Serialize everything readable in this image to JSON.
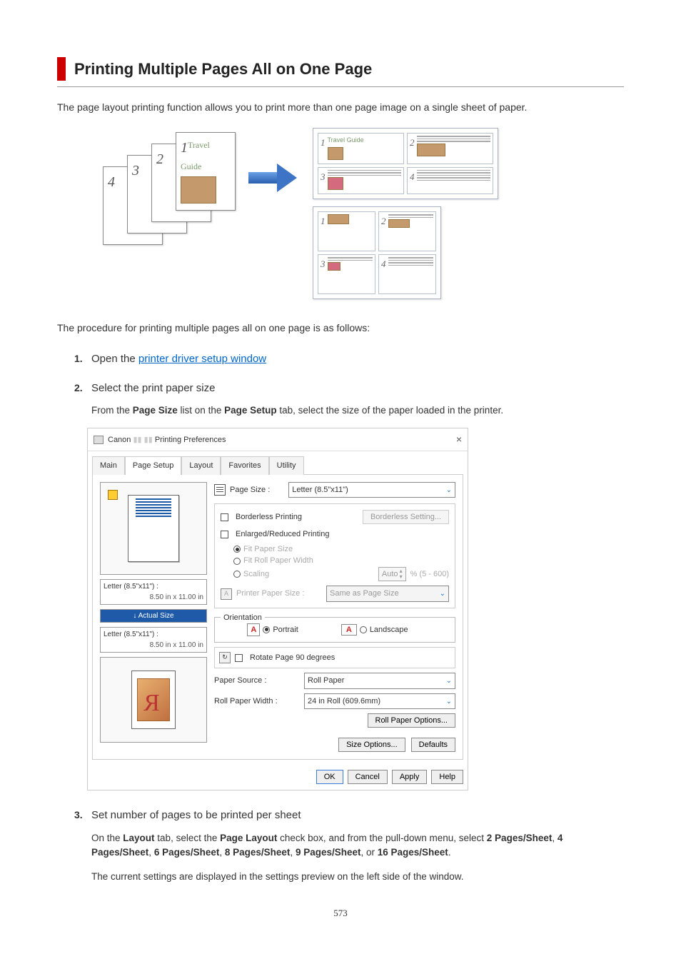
{
  "title": "Printing Multiple Pages All on One Page",
  "intro": "The page layout printing function allows you to print more than one page image on a single sheet of paper.",
  "procedure": "The procedure for printing multiple pages all on one page is as follows:",
  "steps": {
    "s1": {
      "num": "1.",
      "title_pre": "Open the ",
      "link": "printer driver setup window"
    },
    "s2": {
      "num": "2.",
      "title": "Select the print paper size",
      "detail_pre": "From the ",
      "b1": "Page Size",
      "mid1": " list on the ",
      "b2": "Page Setup",
      "post": " tab, select the size of the paper loaded in the printer."
    },
    "s3": {
      "num": "3.",
      "title": "Set number of pages to be printed per sheet",
      "l1_pre": "On the ",
      "l1_b1": "Layout",
      "l1_mid": " tab, select the ",
      "l1_b2": "Page Layout",
      "l1_mid2": " check box, and from the pull-down menu, select ",
      "l1_b3": "2 Pages/Sheet",
      "l1_c1": ", ",
      "l1_b4": "4 Pages/Sheet",
      "l1_c2": ", ",
      "l1_b5": "6 Pages/Sheet",
      "l1_c3": ", ",
      "l1_b6": "8 Pages/Sheet",
      "l1_c4": ", ",
      "l1_b7": "9 Pages/Sheet",
      "l1_c5": ", or ",
      "l1_b8": "16 Pages/Sheet",
      "l1_end": ".",
      "l2": "The current settings are displayed in the settings preview on the left side of the window."
    }
  },
  "dialog": {
    "title_prefix": "Canon",
    "title_suffix": "Printing Preferences",
    "tabs": [
      "Main",
      "Page Setup",
      "Layout",
      "Favorites",
      "Utility"
    ],
    "active_tab": "Page Setup",
    "page_size_label": "Page Size :",
    "page_size_value": "Letter (8.5\"x11\")",
    "borderless": "Borderless Printing",
    "borderless_btn": "Borderless Setting...",
    "enlarged": "Enlarged/Reduced Printing",
    "fit_paper": "Fit Paper Size",
    "fit_roll": "Fit Roll Paper Width",
    "scaling": "Scaling",
    "scaling_val": "Auto",
    "scaling_range": "% (5 - 600)",
    "printer_paper_label": "Printer Paper Size :",
    "printer_paper_value": "Same as Page Size",
    "left_label1": "Letter (8.5\"x11\") :",
    "left_dim1": "8.50 in x 11.00 in",
    "actual_size": "Actual Size",
    "left_label2": "Letter (8.5\"x11\") :",
    "left_dim2": "8.50 in x 11.00 in",
    "orientation": "Orientation",
    "portrait": "Portrait",
    "landscape": "Landscape",
    "rotate": "Rotate Page 90 degrees",
    "paper_source_label": "Paper Source :",
    "paper_source_value": "Roll Paper",
    "roll_width_label": "Roll Paper Width :",
    "roll_width_value": "24 in Roll (609.6mm)",
    "roll_options": "Roll Paper Options...",
    "size_options": "Size Options...",
    "defaults": "Defaults",
    "ok": "OK",
    "cancel": "Cancel",
    "apply": "Apply",
    "help": "Help"
  },
  "illus": {
    "script": "Travel Guide",
    "nums": [
      "1",
      "2",
      "3",
      "4"
    ]
  },
  "pagenum": "573"
}
